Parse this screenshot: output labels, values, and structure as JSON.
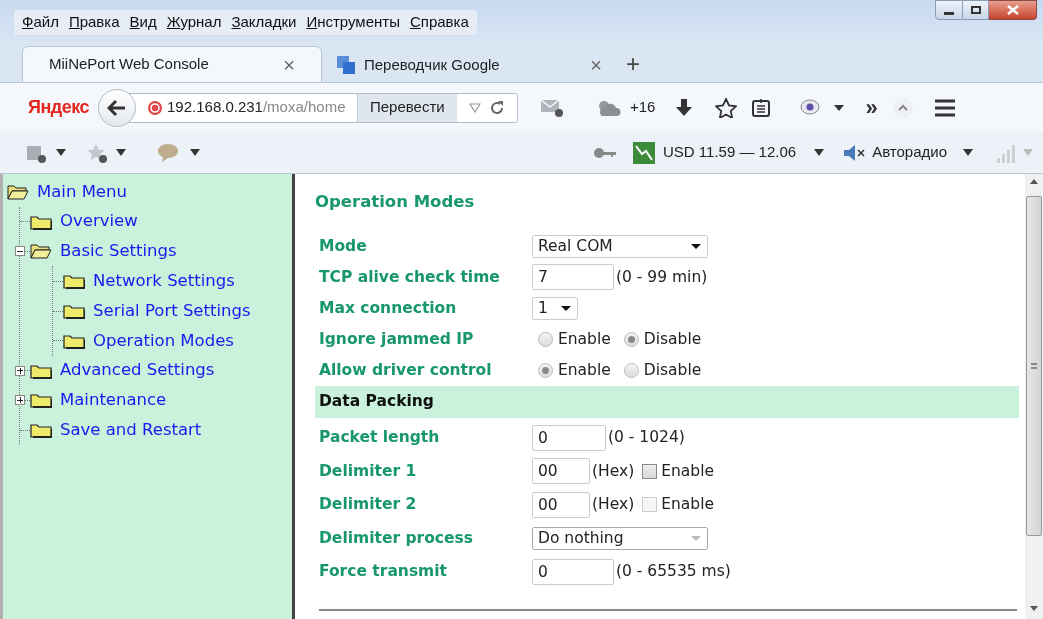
{
  "menu_bar": [
    {
      "label": "Файл"
    },
    {
      "label": "Правка"
    },
    {
      "label": "Вид"
    },
    {
      "label": "Журнал"
    },
    {
      "label": "Закладки"
    },
    {
      "label": "Инструменты"
    },
    {
      "label": "Справка"
    }
  ],
  "tabs": [
    {
      "label": "MiiNePort Web Console",
      "selected": true,
      "close": "×"
    },
    {
      "label": "Переводчик Google",
      "selected": false,
      "close": "×"
    }
  ],
  "new_tab": "+",
  "nav": {
    "logo": "Яндекс",
    "url_host": "192.168.0.231",
    "url_path": "/moxa/home",
    "translate": "Перевести",
    "weather": "+16",
    "more": "»"
  },
  "toolbar2": {
    "currency": "USD 11.59 — 12.06",
    "radio": "Авторадио"
  },
  "sidebar": {
    "items": [
      {
        "label": "Main Menu",
        "expanded": true,
        "children": [
          {
            "label": "Overview"
          },
          {
            "label": "Basic Settings",
            "expanded": true,
            "children": [
              {
                "label": "Network Settings"
              },
              {
                "label": "Serial Port Settings"
              },
              {
                "label": "Operation Modes"
              }
            ]
          },
          {
            "label": "Advanced Settings",
            "expanded": false
          },
          {
            "label": "Maintenance",
            "expanded": false
          },
          {
            "label": "Save and Restart"
          }
        ]
      }
    ]
  },
  "sections": [
    {
      "kind": "title",
      "title": "Operation Modes",
      "rows": [
        {
          "kind": "select",
          "label": "Mode",
          "value": "Real COM",
          "disabled": false,
          "wide": true
        },
        {
          "kind": "input",
          "label": "TCP alive check time",
          "value": "7",
          "hint": "(0 - 99 min)"
        },
        {
          "kind": "select",
          "label": "Max connection",
          "value": "1",
          "disabled": false,
          "wide": false
        },
        {
          "kind": "radios",
          "label": "Ignore jammed IP",
          "options": [
            {
              "label": "Enable",
              "selected": false
            },
            {
              "label": "Disable",
              "selected": true
            }
          ]
        },
        {
          "kind": "radios",
          "label": "Allow driver control",
          "options": [
            {
              "label": "Enable",
              "selected": true
            },
            {
              "label": "Disable",
              "selected": false
            }
          ]
        }
      ]
    },
    {
      "kind": "band",
      "title": "Data Packing",
      "rows": [
        {
          "kind": "input",
          "label": "Packet length",
          "value": "0",
          "hint": "(0 - 1024)"
        },
        {
          "kind": "input",
          "label": "Delimiter 1",
          "value": "00",
          "hint": "(Hex)",
          "check": {
            "label": "Enable",
            "checked": false,
            "disabled": false
          }
        },
        {
          "kind": "input",
          "label": "Delimiter 2",
          "value": "00",
          "hint": "(Hex)",
          "check": {
            "label": "Enable",
            "checked": false,
            "disabled": true
          }
        },
        {
          "kind": "select",
          "label": "Delimiter process",
          "value": "Do nothing",
          "disabled": true,
          "wide": true
        },
        {
          "kind": "input",
          "label": "Force transmit",
          "value": "0",
          "hint": "(0 - 65535 ms)"
        }
      ]
    }
  ]
}
